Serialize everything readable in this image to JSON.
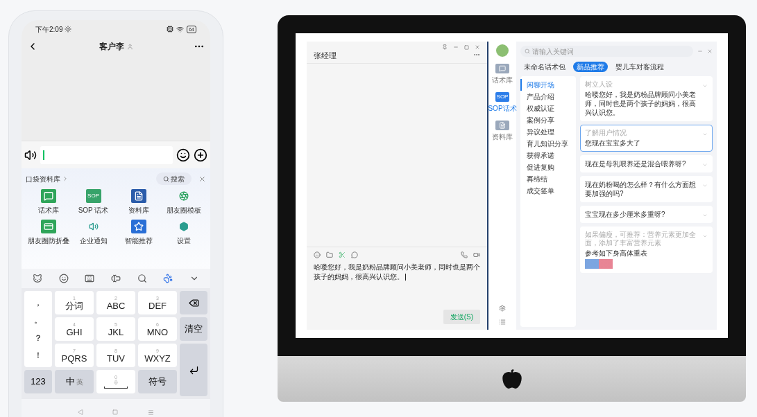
{
  "phone": {
    "status_bar": {
      "time": "下午2:09",
      "battery": "64"
    },
    "nav": {
      "title": "客户李"
    },
    "panel": {
      "title": "口袋资料库",
      "search": "搜索",
      "items": [
        {
          "label": "话术库",
          "kind": "chat"
        },
        {
          "label": "SOP 话术",
          "kind": "sop",
          "badge": "SOP"
        },
        {
          "label": "资料库",
          "kind": "doc"
        },
        {
          "label": "朋友圈模板",
          "kind": "aperture"
        },
        {
          "label": "朋友圈防折叠",
          "kind": "card"
        },
        {
          "label": "企业通知",
          "kind": "speaker"
        },
        {
          "label": "智能推荐",
          "kind": "star"
        },
        {
          "label": "设置",
          "kind": "hex"
        }
      ]
    },
    "keyboard": {
      "punctuation": [
        "，",
        "。",
        "？",
        "！"
      ],
      "keys": [
        {
          "number": "1",
          "label": "分词"
        },
        {
          "number": "2",
          "label": "ABC"
        },
        {
          "number": "3",
          "label": "DEF"
        },
        {
          "number": "4",
          "label": "GHI"
        },
        {
          "number": "5",
          "label": "JKL"
        },
        {
          "number": "6",
          "label": "MNO"
        },
        {
          "number": "7",
          "label": "PQRS"
        },
        {
          "number": "8",
          "label": "TUV"
        },
        {
          "number": "9",
          "label": "WXYZ"
        }
      ],
      "clear": "清空",
      "numbers": "123",
      "lang": "中",
      "lang_alt": "英",
      "space_number": "0",
      "symbols": "符号"
    }
  },
  "desktop": {
    "chat": {
      "title": "张经理",
      "draft": "哈喽您好，我是奶粉品牌顾问小美老师，同时也是两个孩子的妈妈，很高兴认识您。",
      "send": "发送(S)"
    },
    "assistant": {
      "search_placeholder": "请输入关键词",
      "rail": [
        {
          "label": "话术库",
          "kind": "chat",
          "selected": false
        },
        {
          "label": "SOP话术",
          "kind": "sop",
          "badge": "SOP",
          "selected": true
        },
        {
          "label": "资料库",
          "kind": "doc",
          "selected": false
        }
      ],
      "packages": [
        {
          "label": "未命名话术包",
          "selected": false
        },
        {
          "label": "新品推荐",
          "selected": true
        },
        {
          "label": "婴儿车对客流程",
          "selected": false
        }
      ],
      "stages": [
        {
          "label": "闲聊开场",
          "selected": true
        },
        {
          "label": "产品介绍",
          "selected": false
        },
        {
          "label": "权威认证",
          "selected": false
        },
        {
          "label": "案例分享",
          "selected": false
        },
        {
          "label": "异议处理",
          "selected": false
        },
        {
          "label": "育儿知识分享",
          "selected": false
        },
        {
          "label": "获得承诺",
          "selected": false
        },
        {
          "label": "促进复购",
          "selected": false
        },
        {
          "label": "再缔结",
          "selected": false
        },
        {
          "label": "成交签单",
          "selected": false
        }
      ],
      "cards": [
        {
          "heading": "树立人设",
          "text": "哈喽您好，我是奶粉品牌顾问小美老师，同时也是两个孩子的妈妈，很高兴认识您。",
          "selected": false
        },
        {
          "heading": "了解用户情况",
          "text": "您现在宝宝多大了",
          "selected": true
        },
        {
          "text": "现在是母乳喂养还是混合喂养呀?",
          "selected": false
        },
        {
          "text": "现在奶粉喝的怎么样？有什么方面想要加强的吗?",
          "selected": false
        },
        {
          "text": "宝宝现在多少厘米多重呀?",
          "selected": false
        },
        {
          "heading": "如果偏瘦，可推荐：营养元素更加全面，添加了丰富营养元素",
          "text": "参考如下身高体重表",
          "image": true,
          "selected": false
        }
      ]
    }
  }
}
